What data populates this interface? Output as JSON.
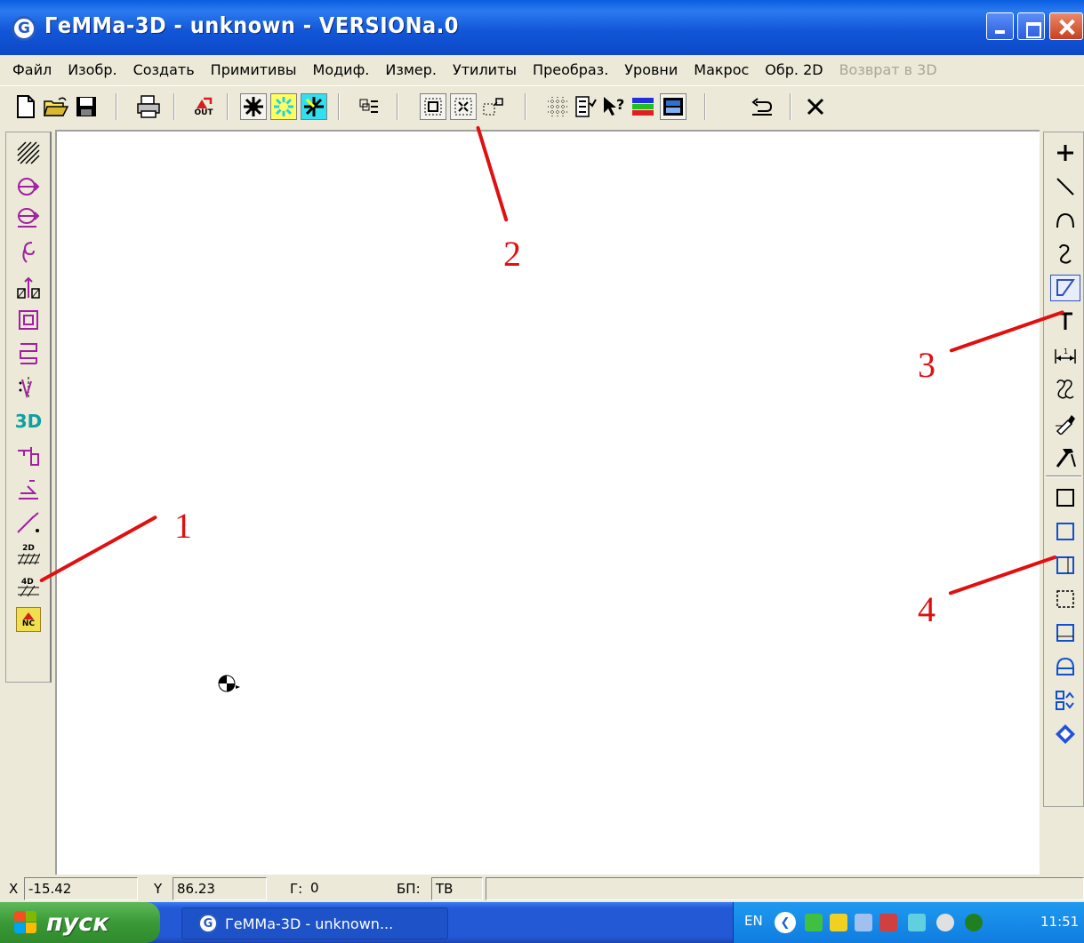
{
  "window": {
    "title": "ГеММа-3D - unknown - VERSIONa.0",
    "app_icon_letter": "G",
    "accent": "#0c52dc"
  },
  "menu": {
    "items": [
      {
        "label": "Файл",
        "enabled": true
      },
      {
        "label": "Изобр.",
        "enabled": true
      },
      {
        "label": "Создать",
        "enabled": true
      },
      {
        "label": "Примитивы",
        "enabled": true
      },
      {
        "label": "Модиф.",
        "enabled": true
      },
      {
        "label": "Измер.",
        "enabled": true
      },
      {
        "label": "Утилиты",
        "enabled": true
      },
      {
        "label": "Преобраз.",
        "enabled": true
      },
      {
        "label": "Уровни",
        "enabled": true
      },
      {
        "label": "Макрос",
        "enabled": true
      },
      {
        "label": "Обр. 2D",
        "enabled": true
      },
      {
        "label": "Возврат в 3D",
        "enabled": false
      }
    ]
  },
  "toolbar": {
    "out_label": "OUT",
    "icons": [
      "new-file-icon",
      "open-folder-icon",
      "save-icon",
      "print-icon",
      "out-icon",
      "star-black-icon",
      "star-yellow-icon",
      "star-cyan-icon",
      "layer-list-icon",
      "zoom-window-icon",
      "zoom-fit-icon",
      "zoom-dynamic-icon",
      "grid-icon",
      "list-check-icon",
      "help-pointer-icon",
      "color-bars-icon",
      "calculator-icon",
      "undo-icon",
      "cancel-icon"
    ]
  },
  "left_toolbar": {
    "text_3d": "3D",
    "text_2d": "2D",
    "text_nc": "NC"
  },
  "annotations": {
    "n1": "1",
    "n2": "2",
    "n3": "3",
    "n4": "4",
    "color": "#e01010"
  },
  "status": {
    "x_label": "X",
    "x_value": "-15.42",
    "y_label": "Y",
    "y_value": "86.23",
    "g_label": "Г:",
    "g_value": "0",
    "bp_label": "БП:",
    "bp_value": "ТВ"
  },
  "taskbar": {
    "start_label": "пуск",
    "task_label": "ГеММа-3D - unknown...",
    "lang": "EN",
    "time": "11:51"
  }
}
